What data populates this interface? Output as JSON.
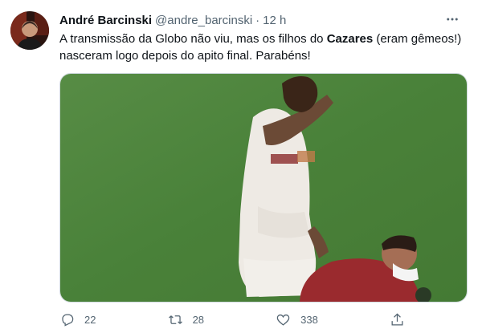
{
  "author": {
    "name": "André Barcinski",
    "handle": "@andre_barcinski",
    "separator": "·",
    "time": "12 h"
  },
  "tweet": {
    "text_part1": "A transmissão da Globo não viu, mas os filhos do ",
    "mention_bold": "Cazares",
    "text_part2": " (eram gêmeos!) nasceram logo depois do apito final. Parabéns!"
  },
  "icons": {
    "more": "more-icon",
    "reply": "reply-icon",
    "retweet": "retweet-icon",
    "like": "heart-icon",
    "share": "share-icon"
  },
  "actions": {
    "replies": "22",
    "retweets": "28",
    "likes": "338"
  },
  "colors": {
    "text": "#0f1419",
    "secondary": "#536471",
    "pitch_green": "#4f8a3f"
  }
}
